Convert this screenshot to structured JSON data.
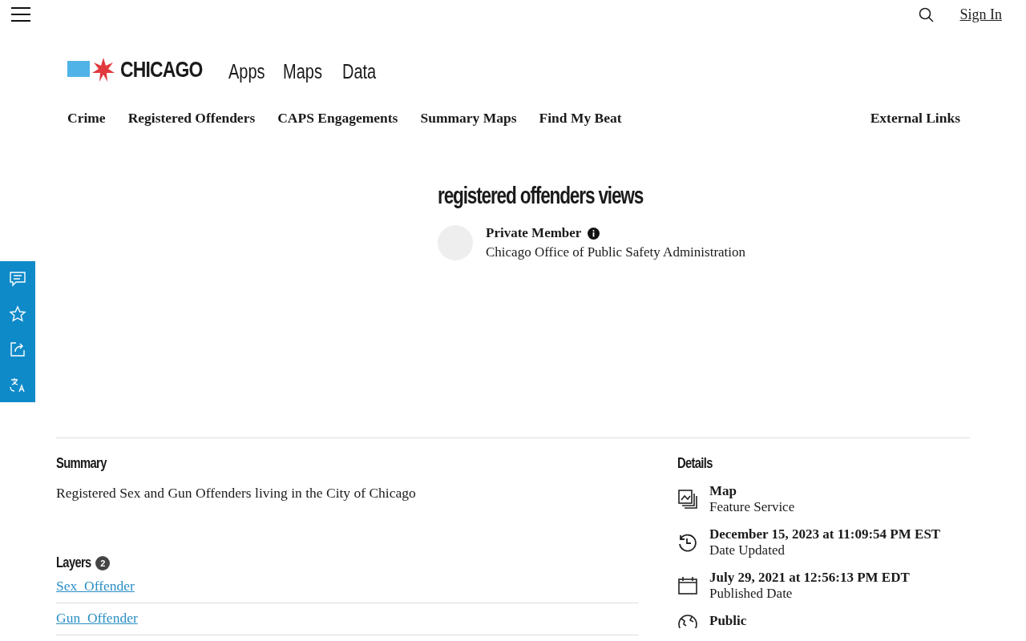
{
  "top_bar": {
    "sign_in": "Sign In"
  },
  "header": {
    "logo_text": "CHICAGO",
    "menu": [
      "Apps",
      "Maps",
      "Data"
    ]
  },
  "nav": {
    "items": [
      {
        "label": "Crime"
      },
      {
        "label": "Registered Offenders"
      },
      {
        "label": "CAPS Engagements"
      },
      {
        "label": "Summary Maps"
      },
      {
        "label": "Find My Beat"
      }
    ],
    "external": "External Links"
  },
  "item": {
    "title": "registered offenders views",
    "owner": "Private Member",
    "organization": "Chicago Office of Public Safety Administration"
  },
  "side_toolbar": [
    {
      "kind": "comment"
    },
    {
      "kind": "favorite"
    },
    {
      "kind": "share"
    },
    {
      "kind": "translate"
    }
  ],
  "summary": {
    "heading": "Summary",
    "text": "Registered Sex and Gun Offenders living in the City of Chicago"
  },
  "layers": {
    "heading": "Layers",
    "count": "2",
    "items": [
      "Sex_Offender",
      "Gun_Offender"
    ]
  },
  "details": {
    "heading": "Details",
    "rows": [
      {
        "kind": "map",
        "title": "Map",
        "subtitle": "Feature Service"
      },
      {
        "kind": "updated",
        "title": "December 15, 2023 at 11:09:54 PM EST",
        "subtitle": "Date Updated"
      },
      {
        "kind": "published",
        "title": "July 29, 2021 at 12:56:13 PM EDT",
        "subtitle": "Published Date"
      },
      {
        "kind": "public",
        "title": "Public"
      }
    ]
  }
}
